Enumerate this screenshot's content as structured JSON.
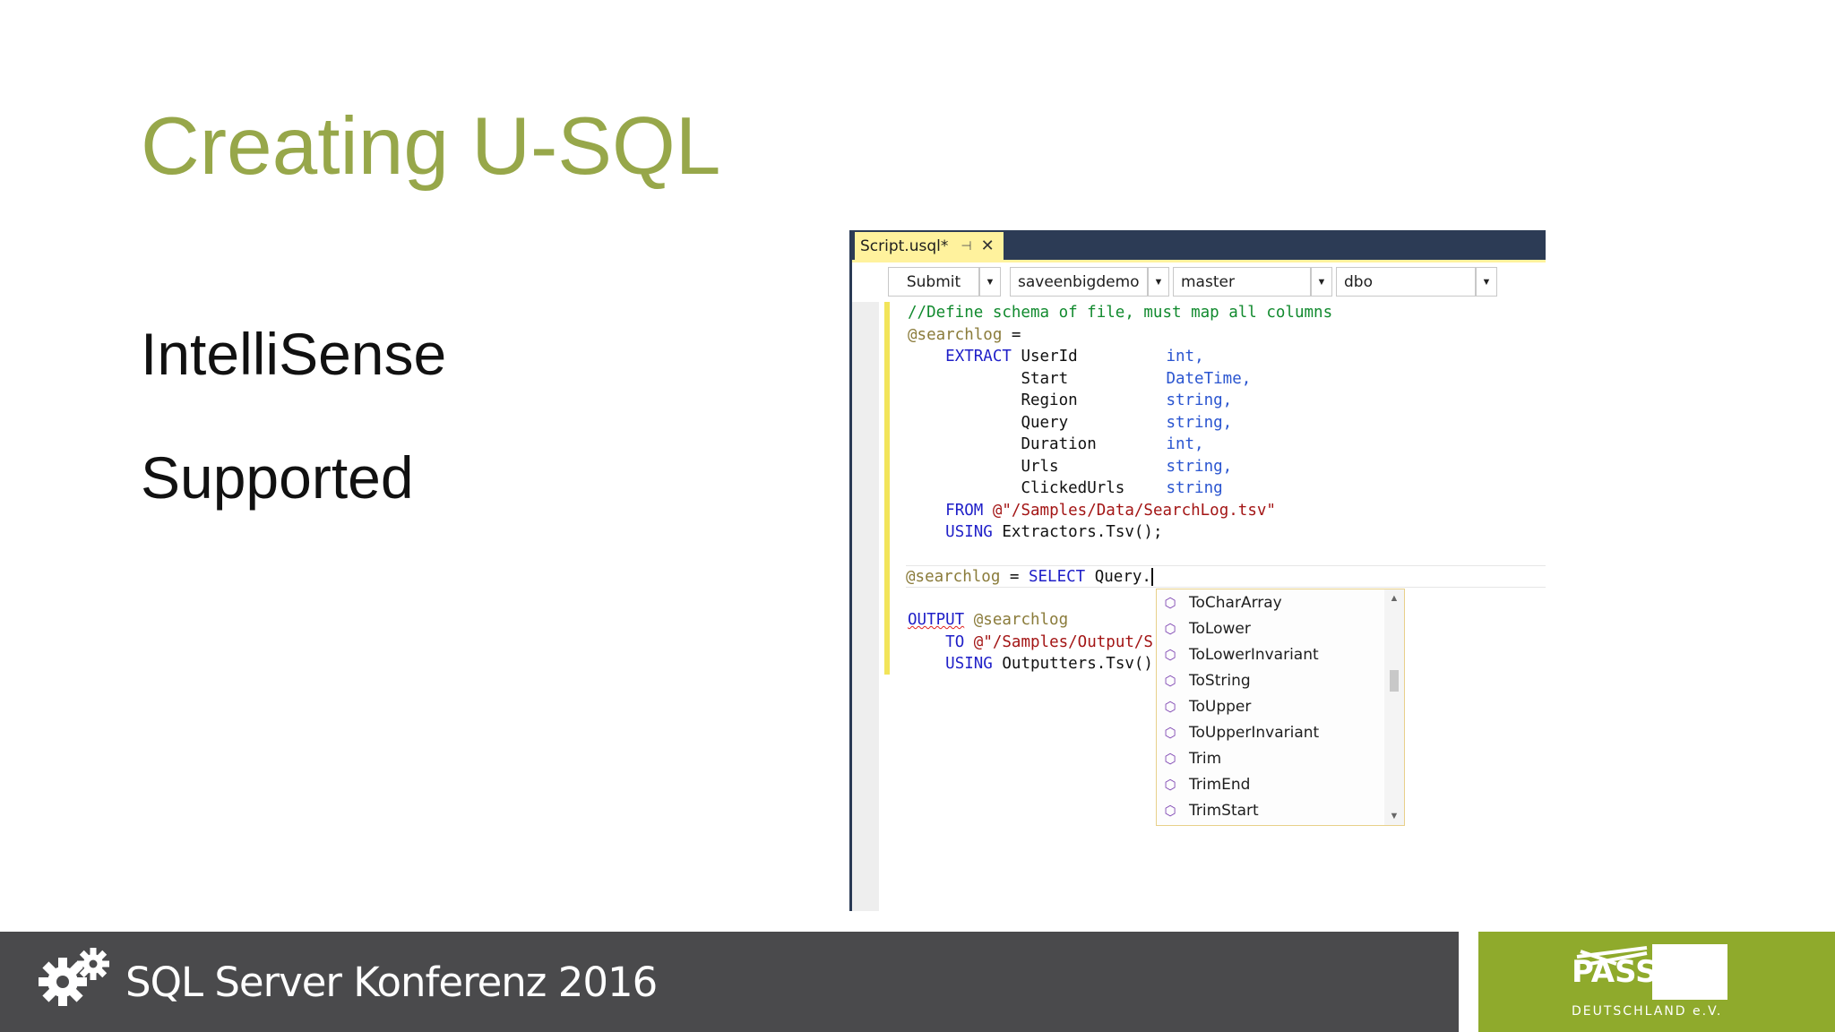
{
  "slide": {
    "title": "Creating U-SQL",
    "bullets": [
      "IntelliSense",
      "Supported"
    ]
  },
  "editor": {
    "tab": {
      "label": "Script.usql*",
      "pin_icon": "pin-icon",
      "close_icon": "close-icon"
    },
    "toolbar": {
      "submit_label": "Submit",
      "account": "saveenbigdemo",
      "database": "master",
      "schema": "dbo"
    },
    "code": {
      "comment": "//Define schema of file, must map all columns",
      "var1": "@searchlog",
      "eq": " =",
      "extract_kw": "EXTRACT",
      "columns": [
        {
          "name": "UserId",
          "type": "int,"
        },
        {
          "name": "Start",
          "type": "DateTime,"
        },
        {
          "name": "Region",
          "type": "string,"
        },
        {
          "name": "Query",
          "type": "string,"
        },
        {
          "name": "Duration",
          "type": "int,"
        },
        {
          "name": "Urls",
          "type": "string,"
        },
        {
          "name": "ClickedUrls",
          "type": "string"
        }
      ],
      "from_kw": "FROM",
      "from_path": "@\"/Samples/Data/SearchLog.tsv\"",
      "using_kw": "USING",
      "extractor": "Extractors.Tsv();",
      "select_var": "@searchlog",
      "select_eq": " = ",
      "select_kw": "SELECT",
      "select_rest": " Query.",
      "output_kw": "OUTPUT",
      "output_var": "@searchlog",
      "to_kw": "TO",
      "to_path": "@\"/Samples/Output/S",
      "using2_kw": "USING",
      "outputter": "Outputters.Tsv()"
    },
    "intellisense": {
      "items": [
        "ToCharArray",
        "ToLower",
        "ToLowerInvariant",
        "ToString",
        "ToUpper",
        "ToUpperInvariant",
        "Trim",
        "TrimEnd",
        "TrimStart"
      ],
      "item_icon": "method-icon"
    }
  },
  "footer": {
    "conference": "SQL Server Konferenz 2016",
    "pass_logo": "PASS",
    "pass_sub": "DEUTSCHLAND e.V."
  },
  "colors": {
    "title": "#97a74a",
    "footer_bg": "#4a4a4c",
    "pass_bg": "#8faa2c",
    "tab_active": "#fff29d",
    "tab_strip": "#2c3b55"
  }
}
